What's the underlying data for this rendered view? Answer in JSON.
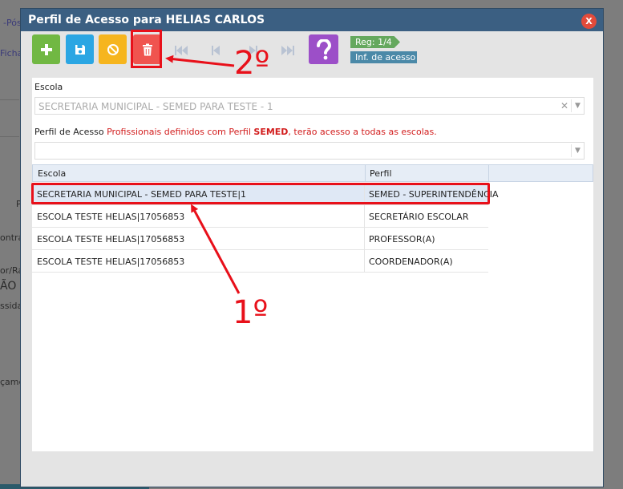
{
  "background": {
    "fragments": [
      "-Pós",
      "Ficha",
      "P",
      "ontrat",
      "or/Rac",
      "ÃO",
      "ssida",
      "çame"
    ]
  },
  "dialog": {
    "title": "Perfil de Acesso para HELIAS CARLOS",
    "close_label": "X"
  },
  "toolbar": {
    "record_label": "Reg: 1/4",
    "info_label": "Inf. de acesso"
  },
  "form": {
    "escola_label": "Escola",
    "escola_value": "SECRETARIA MUNICIPAL - SEMED PARA TESTE - 1",
    "perfil_label": "Perfil de Acesso",
    "perfil_note_pre": "Profissionais definidos com Perfil",
    "perfil_note_bold": "SEMED",
    "perfil_note_post": ", terão acesso a todas as escolas.",
    "perfil_value": ""
  },
  "grid": {
    "columns": [
      "Escola",
      "Perfil"
    ],
    "rows": [
      {
        "escola": "SECRETARIA MUNICIPAL - SEMED PARA TESTE|1",
        "perfil": "SEMED - SUPERINTENDÊNCIA"
      },
      {
        "escola": "ESCOLA TESTE HELIAS|17056853",
        "perfil": "SECRETÁRIO ESCOLAR"
      },
      {
        "escola": "ESCOLA TESTE HELIAS|17056853",
        "perfil": "PROFESSOR(A)"
      },
      {
        "escola": "ESCOLA TESTE HELIAS|17056853",
        "perfil": "COORDENADOR(A)"
      }
    ]
  },
  "annotations": {
    "step1": "1º",
    "step2": "2º"
  },
  "colors": {
    "add": "#71b843",
    "save": "#2ba6e3",
    "cancel": "#f6b51e",
    "delete": "#f0544f",
    "help": "#9c4fc8",
    "highlight": "#e8101a"
  },
  "icons": [
    "plus-icon",
    "save-icon",
    "cancel-icon",
    "trash-icon",
    "first-icon",
    "prev-icon",
    "next-icon",
    "last-icon",
    "help-icon",
    "close-icon"
  ]
}
